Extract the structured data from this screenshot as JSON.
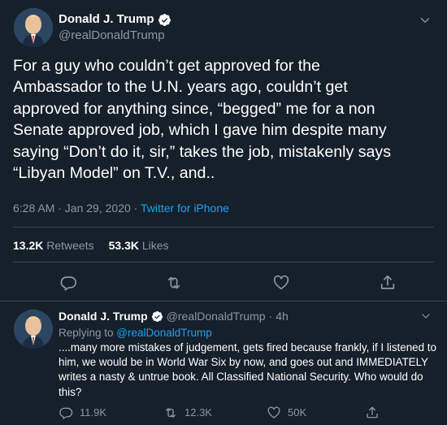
{
  "main_tweet": {
    "display_name": "Donald J. Trump",
    "handle": "@realDonaldTrump",
    "text": "For a guy who couldn’t get approved for the\nAmbassador to the U.N. years ago, couldn’t get\napproved for anything since, “begged” me for a non\nSenate approved job, which I gave him despite many\nsaying “Don’t do it, sir,” takes the job, mistakenly says\n“Libyan Model” on T.V., and..",
    "timestamp": "6:28 AM · Jan 29, 2020",
    "meta_separator": " · ",
    "source": "Twitter for iPhone",
    "retweets_count": "13.2K",
    "retweets_label": "Retweets",
    "likes_count": "53.3K",
    "likes_label": "Likes"
  },
  "reply_tweet": {
    "display_name": "Donald J. Trump",
    "handle": "@realDonaldTrump",
    "dot": "·",
    "time": "4h",
    "replying_label": "Replying to ",
    "replying_to": "@realDonaldTrump",
    "text": "....many more mistakes of judgement, gets fired because frankly, if I listened to\nhim, we would be in World War Six by now, and goes out and IMMEDIATELY\nwrites a nasty & untrue book. All Classified National Security. Who would do\nthis?",
    "reply_count": "11.9K",
    "retweet_count": "12.3K",
    "like_count": "50K"
  },
  "icons": {
    "verified": "verified-badge-icon",
    "reply": "reply-bubble-icon",
    "retweet": "retweet-icon",
    "like": "heart-icon",
    "share": "share-icon",
    "more": "chevron-down-icon"
  },
  "colors": {
    "background": "#15202b",
    "accent": "#1da1f2",
    "secondary_text": "#8899a6",
    "divider": "#38444d"
  }
}
